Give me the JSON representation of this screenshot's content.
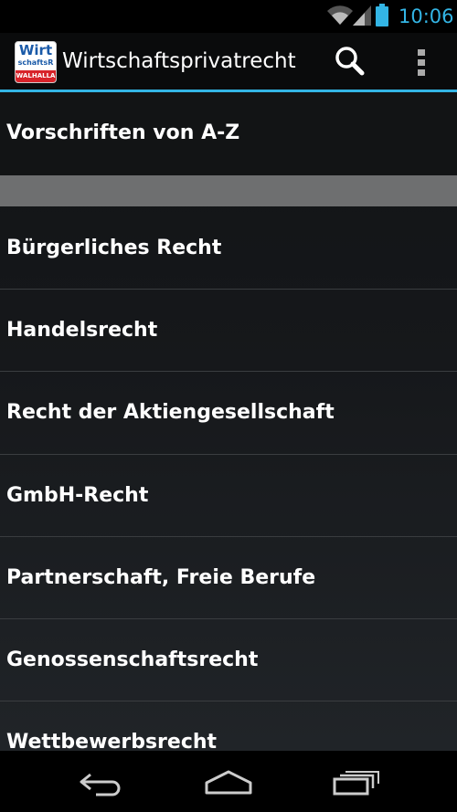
{
  "status_bar": {
    "time": "10:06",
    "icons": [
      "wifi-icon",
      "signal-icon",
      "battery-icon"
    ],
    "clock_color": "#33b5e5"
  },
  "action_bar": {
    "logo": {
      "line1": "Wirt",
      "line2": "schaftsR",
      "line3": "WALHALLA"
    },
    "title": "Wirtschaftsprivatrecht",
    "actions": [
      "search-icon",
      "overflow-menu-icon"
    ],
    "accent_color": "#33b5e5"
  },
  "list": {
    "top_item": "Vorschriften von A-Z",
    "items": [
      "Bürgerliches Recht",
      "Handelsrecht",
      "Recht der Aktiengesellschaft",
      "GmbH-Recht",
      "Partnerschaft, Freie Berufe",
      "Genossenschaftsrecht",
      "Wettbewerbsrecht"
    ]
  },
  "nav_bar": {
    "buttons": [
      "back-icon",
      "home-icon",
      "recent-apps-icon"
    ]
  }
}
